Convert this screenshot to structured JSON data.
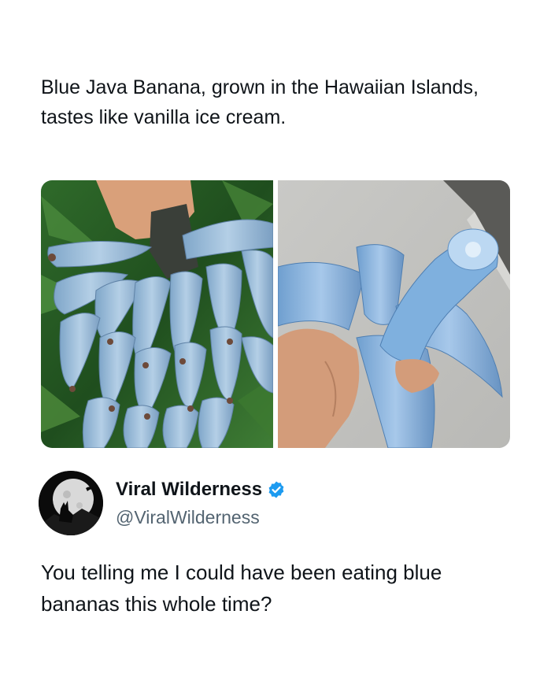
{
  "post": {
    "caption": "Blue Java Banana, grown in the Hawaiian Islands, tastes like vanilla ice cream.",
    "media": [
      {
        "icon": "banana-bunch-photo"
      },
      {
        "icon": "peeled-banana-photo"
      }
    ]
  },
  "author": {
    "display_name": "Viral Wilderness",
    "handle": "@ViralWilderness",
    "avatar_icon": "wolf-moon-avatar",
    "verified_icon": "verified-badge-icon",
    "verified_color": "#1d9bf0"
  },
  "tweet": {
    "text": "You telling me I could have been eating blue bananas this whole time?"
  },
  "colors": {
    "text": "#0f1419",
    "secondary_text": "#536471",
    "banana_blue": "#8fb4d6"
  }
}
